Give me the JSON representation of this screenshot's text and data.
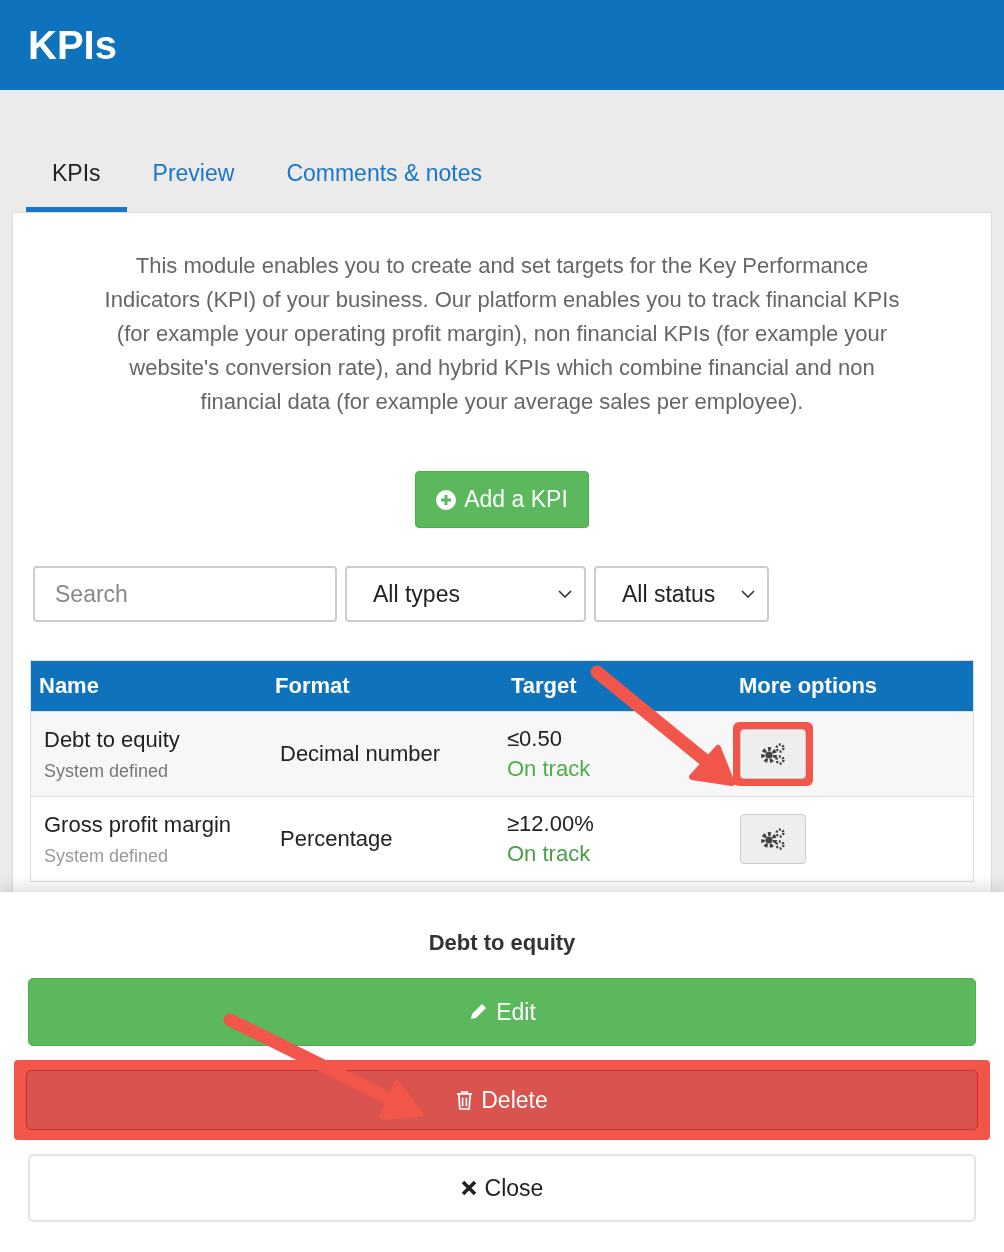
{
  "header": {
    "title": "KPIs"
  },
  "tabs": [
    {
      "label": "KPIs",
      "selected": true
    },
    {
      "label": "Preview",
      "selected": false
    },
    {
      "label": "Comments & notes",
      "selected": false
    }
  ],
  "intro": "This module enables you to create and set targets for the Key Performance Indicators (KPI) of your business. Our platform enables you to track financial KPIs (for example your operating profit margin), non financial KPIs (for example your website's conversion rate), and hybrid KPIs which combine financial and non financial data (for example your average sales per employee).",
  "add_button": "Add a KPI",
  "search": {
    "placeholder": "Search"
  },
  "filters": [
    {
      "value": "All types"
    },
    {
      "value": "All status"
    }
  ],
  "table": {
    "columns": [
      "Name",
      "Format",
      "Target",
      "More options"
    ],
    "rows": [
      {
        "name": "Debt to equity",
        "source": "System defined",
        "format": "Decimal number",
        "target": "≤0.50",
        "status": "On track",
        "highlighted": true
      },
      {
        "name": "Gross profit margin",
        "source": "System defined",
        "format": "Percentage",
        "target": "≥12.00%",
        "status": "On track",
        "highlighted": false
      }
    ]
  },
  "sheet": {
    "title": "Debt to equity",
    "actions": [
      {
        "kind": "edit",
        "label": "Edit",
        "highlighted": false
      },
      {
        "kind": "delete",
        "label": "Delete",
        "highlighted": true
      },
      {
        "kind": "close",
        "label": "Close",
        "highlighted": false
      }
    ]
  }
}
